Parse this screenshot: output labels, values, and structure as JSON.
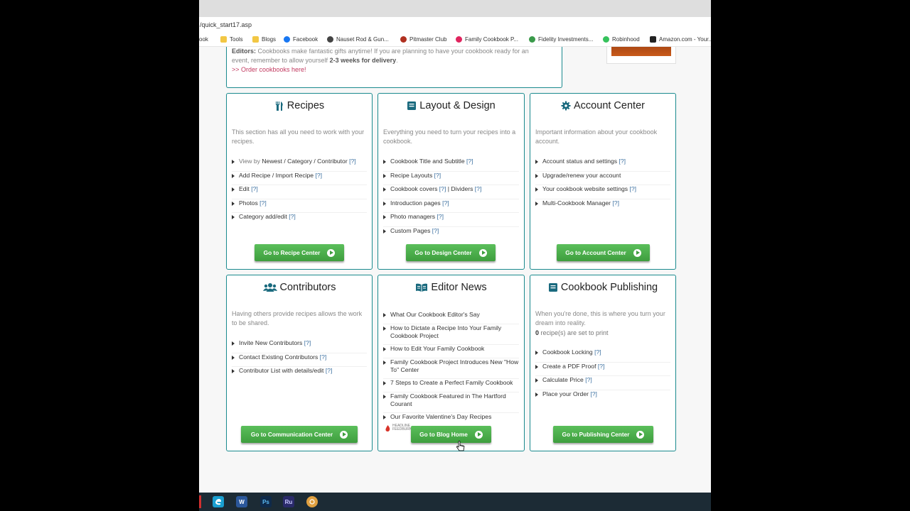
{
  "browser": {
    "url": "/quick_start17.asp",
    "bookmarks": [
      {
        "label": "ook",
        "color": "#ffffff"
      },
      {
        "label": "Tools",
        "color": "#f2c744"
      },
      {
        "label": "Blogs",
        "color": "#f2c744"
      },
      {
        "label": "Facebook",
        "color": "#1877f2"
      },
      {
        "label": "Nauset Rod & Gun...",
        "color": "#444444"
      },
      {
        "label": "Pitmaster Club",
        "color": "#b03020"
      },
      {
        "label": "Family Cookbook P...",
        "color": "#e0245e"
      },
      {
        "label": "Fidelity Investments...",
        "color": "#3a9a4a"
      },
      {
        "label": "Robinhood",
        "color": "#36c25c"
      },
      {
        "label": "Amazon.com - Your...",
        "color": "#222222"
      }
    ]
  },
  "editor_note": {
    "line1_bold": "Editors:",
    "line1": "Cookbooks make fantastic gifts anytime! If you are planning to have your cookbook ready for an",
    "line2_prefix": "event, remember to allow yourself",
    "line2_bold": "2-3 weeks for delivery",
    "line2_suffix": ".",
    "link": ">> Order cookbooks here!"
  },
  "cards": {
    "recipes": {
      "title": "Recipes",
      "desc": "This section has all you need to work with your recipes.",
      "items": [
        {
          "pre": "View by ",
          "text": "Newest / Category / Contributor",
          "q": "[?]"
        },
        {
          "text": "Add Recipe / Import Recipe",
          "q": "[?]"
        },
        {
          "text": "Edit",
          "q": "[?]"
        },
        {
          "text": "Photos",
          "q": "[?]"
        },
        {
          "text": "Category add/edit",
          "q": "[?]"
        }
      ],
      "button": "Go to Recipe Center"
    },
    "layout": {
      "title": "Layout & Design",
      "desc": "Everything you need to turn your recipes into a cookbook.",
      "items": [
        {
          "text": "Cookbook Title and Subtitle",
          "q": "[?]"
        },
        {
          "text": "Recipe Layouts",
          "q": "[?]"
        },
        {
          "text": "Cookbook covers",
          "q": "[?]",
          "text2": " | Dividers",
          "q2": "[?]"
        },
        {
          "text": "Introduction pages",
          "q": "[?]"
        },
        {
          "text": "Photo managers",
          "q": "[?]"
        },
        {
          "text": "Custom Pages",
          "q": "[?]"
        }
      ],
      "button": "Go to Design Center"
    },
    "account": {
      "title": "Account Center",
      "desc": "Important information about your cookbook account.",
      "items": [
        {
          "text": "Account status and settings",
          "q": "[?]"
        },
        {
          "text": "Upgrade/renew your account",
          "q": ""
        },
        {
          "text": "Your cookbook website settings",
          "q": "[?]"
        },
        {
          "text": "Multi-Cookbook Manager",
          "q": "[?]"
        }
      ],
      "button": "Go to Account Center"
    },
    "contributors": {
      "title": "Contributors",
      "desc": "Having others provide recipes allows the work to be shared.",
      "items": [
        {
          "text": "Invite New Contributors",
          "q": "[?]"
        },
        {
          "text": "Contact Existing Contributors",
          "q": "[?]"
        },
        {
          "text": "Contributor List with details/edit",
          "q": "[?]"
        }
      ],
      "button": "Go to Communication Center"
    },
    "news": {
      "title": "Editor News",
      "items": [
        {
          "text": "What Our Cookbook Editor's Say"
        },
        {
          "text": "How to Dictate a Recipe Into Your Family Cookbook Project"
        },
        {
          "text": "How to Edit Your Family Cookbook"
        },
        {
          "text": "Family Cookbook Project Introduces New \"How To\" Center"
        },
        {
          "text": "7 Steps to Create a Perfect Family Cookbook"
        },
        {
          "text": "Family Cookbook Featured in The Hartford Courant"
        },
        {
          "text": "Our Favorite Valentine's Day Recipes"
        }
      ],
      "feed_label": "HEADLINE FEEDBURNER",
      "button": "Go to Blog Home"
    },
    "publishing": {
      "title": "Cookbook Publishing",
      "desc": "When you're done, this is where you turn your dream into reality.",
      "count": "0",
      "count_text": " recipe(s) are set to print",
      "items": [
        {
          "text": "Cookbook Locking",
          "q": "[?]"
        },
        {
          "text": "Create a PDF Proof",
          "q": "[?]"
        },
        {
          "text": "Calculate Price",
          "q": "[?]"
        },
        {
          "text": "Place your Order",
          "q": "[?]"
        }
      ],
      "button": "Go to Publishing Center"
    }
  },
  "taskbar": {
    "apps": [
      {
        "name": "Edge",
        "label": "",
        "color": "#1a9fd0"
      },
      {
        "name": "Word",
        "label": "W",
        "color": "#2b579a"
      },
      {
        "name": "Photoshop",
        "label": "Ps",
        "color": "#0f2a4a"
      },
      {
        "name": "Rush",
        "label": "Ru",
        "color": "#2a2a6a"
      },
      {
        "name": "App",
        "label": "",
        "color": "#e0a040"
      }
    ]
  },
  "colors": {
    "accent": "#1a8a8e",
    "button": "#4caf50",
    "link": "#3a6fa0"
  }
}
